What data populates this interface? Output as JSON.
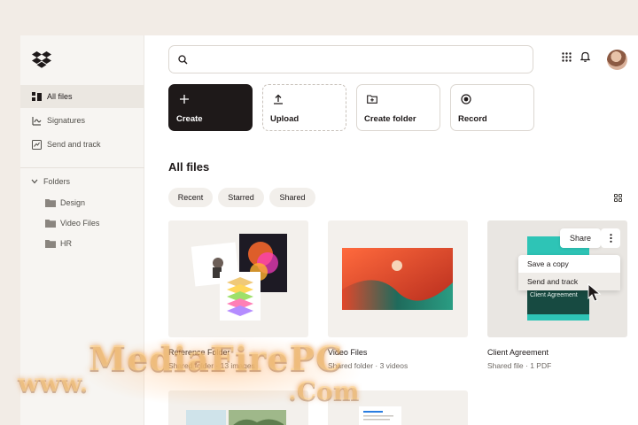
{
  "sidebar": {
    "nav": [
      {
        "label": "All files",
        "icon": "files-icon"
      },
      {
        "label": "Signatures",
        "icon": "signature-icon"
      },
      {
        "label": "Send and track",
        "icon": "send-track-icon"
      }
    ],
    "folders_label": "Folders",
    "folders": [
      {
        "label": "Design"
      },
      {
        "label": "Video Files"
      },
      {
        "label": "HR"
      }
    ]
  },
  "search": {
    "placeholder": ""
  },
  "actions": [
    {
      "label": "Create",
      "icon": "plus-icon"
    },
    {
      "label": "Upload",
      "icon": "upload-icon"
    },
    {
      "label": "Create folder",
      "icon": "folder-plus-icon"
    },
    {
      "label": "Record",
      "icon": "record-icon"
    }
  ],
  "section_title": "All files",
  "filters": [
    "Recent",
    "Starred",
    "Shared"
  ],
  "cards": [
    {
      "title": "Reference Folder",
      "meta": "Shared folder · 13 images"
    },
    {
      "title": "Video Files",
      "meta": "Shared folder · 3 videos"
    },
    {
      "title": "Client Agreement",
      "meta": "Shared file · 1 PDF",
      "thumb_text": "Client Agreement"
    }
  ],
  "share_label": "Share",
  "context_menu": [
    "Save a copy",
    "Send and track"
  ],
  "watermark": {
    "line1": "MediaFirePC",
    "prefix": "www.",
    "suffix": ".Com"
  },
  "colors": {
    "accent_dark": "#1e1919",
    "sidebar_bg": "#f7f5f2",
    "teal": "#2ec4b6",
    "page_bg": "#f2ece6"
  }
}
